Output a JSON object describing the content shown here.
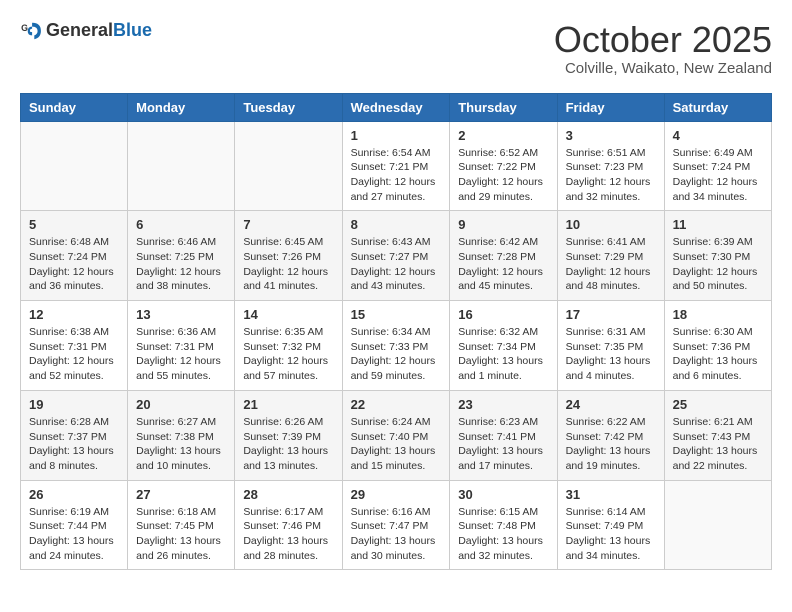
{
  "header": {
    "logo_general": "General",
    "logo_blue": "Blue",
    "month_title": "October 2025",
    "location": "Colville, Waikato, New Zealand"
  },
  "weekdays": [
    "Sunday",
    "Monday",
    "Tuesday",
    "Wednesday",
    "Thursday",
    "Friday",
    "Saturday"
  ],
  "weeks": [
    [
      {
        "day": "",
        "info": ""
      },
      {
        "day": "",
        "info": ""
      },
      {
        "day": "",
        "info": ""
      },
      {
        "day": "1",
        "info": "Sunrise: 6:54 AM\nSunset: 7:21 PM\nDaylight: 12 hours and 27 minutes."
      },
      {
        "day": "2",
        "info": "Sunrise: 6:52 AM\nSunset: 7:22 PM\nDaylight: 12 hours and 29 minutes."
      },
      {
        "day": "3",
        "info": "Sunrise: 6:51 AM\nSunset: 7:23 PM\nDaylight: 12 hours and 32 minutes."
      },
      {
        "day": "4",
        "info": "Sunrise: 6:49 AM\nSunset: 7:24 PM\nDaylight: 12 hours and 34 minutes."
      }
    ],
    [
      {
        "day": "5",
        "info": "Sunrise: 6:48 AM\nSunset: 7:24 PM\nDaylight: 12 hours and 36 minutes."
      },
      {
        "day": "6",
        "info": "Sunrise: 6:46 AM\nSunset: 7:25 PM\nDaylight: 12 hours and 38 minutes."
      },
      {
        "day": "7",
        "info": "Sunrise: 6:45 AM\nSunset: 7:26 PM\nDaylight: 12 hours and 41 minutes."
      },
      {
        "day": "8",
        "info": "Sunrise: 6:43 AM\nSunset: 7:27 PM\nDaylight: 12 hours and 43 minutes."
      },
      {
        "day": "9",
        "info": "Sunrise: 6:42 AM\nSunset: 7:28 PM\nDaylight: 12 hours and 45 minutes."
      },
      {
        "day": "10",
        "info": "Sunrise: 6:41 AM\nSunset: 7:29 PM\nDaylight: 12 hours and 48 minutes."
      },
      {
        "day": "11",
        "info": "Sunrise: 6:39 AM\nSunset: 7:30 PM\nDaylight: 12 hours and 50 minutes."
      }
    ],
    [
      {
        "day": "12",
        "info": "Sunrise: 6:38 AM\nSunset: 7:31 PM\nDaylight: 12 hours and 52 minutes."
      },
      {
        "day": "13",
        "info": "Sunrise: 6:36 AM\nSunset: 7:31 PM\nDaylight: 12 hours and 55 minutes."
      },
      {
        "day": "14",
        "info": "Sunrise: 6:35 AM\nSunset: 7:32 PM\nDaylight: 12 hours and 57 minutes."
      },
      {
        "day": "15",
        "info": "Sunrise: 6:34 AM\nSunset: 7:33 PM\nDaylight: 12 hours and 59 minutes."
      },
      {
        "day": "16",
        "info": "Sunrise: 6:32 AM\nSunset: 7:34 PM\nDaylight: 13 hours and 1 minute."
      },
      {
        "day": "17",
        "info": "Sunrise: 6:31 AM\nSunset: 7:35 PM\nDaylight: 13 hours and 4 minutes."
      },
      {
        "day": "18",
        "info": "Sunrise: 6:30 AM\nSunset: 7:36 PM\nDaylight: 13 hours and 6 minutes."
      }
    ],
    [
      {
        "day": "19",
        "info": "Sunrise: 6:28 AM\nSunset: 7:37 PM\nDaylight: 13 hours and 8 minutes."
      },
      {
        "day": "20",
        "info": "Sunrise: 6:27 AM\nSunset: 7:38 PM\nDaylight: 13 hours and 10 minutes."
      },
      {
        "day": "21",
        "info": "Sunrise: 6:26 AM\nSunset: 7:39 PM\nDaylight: 13 hours and 13 minutes."
      },
      {
        "day": "22",
        "info": "Sunrise: 6:24 AM\nSunset: 7:40 PM\nDaylight: 13 hours and 15 minutes."
      },
      {
        "day": "23",
        "info": "Sunrise: 6:23 AM\nSunset: 7:41 PM\nDaylight: 13 hours and 17 minutes."
      },
      {
        "day": "24",
        "info": "Sunrise: 6:22 AM\nSunset: 7:42 PM\nDaylight: 13 hours and 19 minutes."
      },
      {
        "day": "25",
        "info": "Sunrise: 6:21 AM\nSunset: 7:43 PM\nDaylight: 13 hours and 22 minutes."
      }
    ],
    [
      {
        "day": "26",
        "info": "Sunrise: 6:19 AM\nSunset: 7:44 PM\nDaylight: 13 hours and 24 minutes."
      },
      {
        "day": "27",
        "info": "Sunrise: 6:18 AM\nSunset: 7:45 PM\nDaylight: 13 hours and 26 minutes."
      },
      {
        "day": "28",
        "info": "Sunrise: 6:17 AM\nSunset: 7:46 PM\nDaylight: 13 hours and 28 minutes."
      },
      {
        "day": "29",
        "info": "Sunrise: 6:16 AM\nSunset: 7:47 PM\nDaylight: 13 hours and 30 minutes."
      },
      {
        "day": "30",
        "info": "Sunrise: 6:15 AM\nSunset: 7:48 PM\nDaylight: 13 hours and 32 minutes."
      },
      {
        "day": "31",
        "info": "Sunrise: 6:14 AM\nSunset: 7:49 PM\nDaylight: 13 hours and 34 minutes."
      },
      {
        "day": "",
        "info": ""
      }
    ]
  ]
}
